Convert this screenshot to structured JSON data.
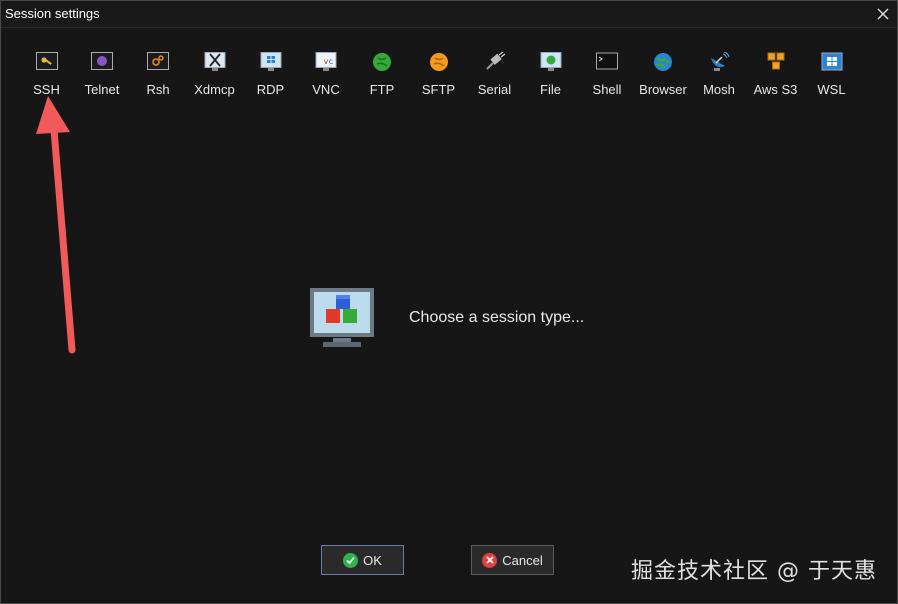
{
  "window": {
    "title": "Session settings"
  },
  "session_types": [
    {
      "label": "SSH",
      "icon": "key-icon"
    },
    {
      "label": "Telnet",
      "icon": "telnet-icon"
    },
    {
      "label": "Rsh",
      "icon": "rsh-icon"
    },
    {
      "label": "Xdmcp",
      "icon": "x-display-icon"
    },
    {
      "label": "RDP",
      "icon": "rdp-monitor-icon"
    },
    {
      "label": "VNC",
      "icon": "vnc-icon"
    },
    {
      "label": "FTP",
      "icon": "ftp-globe-icon"
    },
    {
      "label": "SFTP",
      "icon": "sftp-globe-icon"
    },
    {
      "label": "Serial",
      "icon": "serial-plug-icon"
    },
    {
      "label": "File",
      "icon": "file-monitor-icon"
    },
    {
      "label": "Shell",
      "icon": "shell-terminal-icon"
    },
    {
      "label": "Browser",
      "icon": "browser-globe-icon"
    },
    {
      "label": "Mosh",
      "icon": "satellite-dish-icon"
    },
    {
      "label": "Aws S3",
      "icon": "aws-cubes-icon"
    },
    {
      "label": "WSL",
      "icon": "windows-icon"
    }
  ],
  "main": {
    "prompt": "Choose a session type..."
  },
  "buttons": {
    "ok": "OK",
    "cancel": "Cancel"
  },
  "watermark": "掘金技术社区 @ 于天惠",
  "colors": {
    "background": "#161617",
    "arrow": "#f05a5a",
    "ok_icon": "#2fb34a",
    "cancel_icon": "#e04040"
  }
}
